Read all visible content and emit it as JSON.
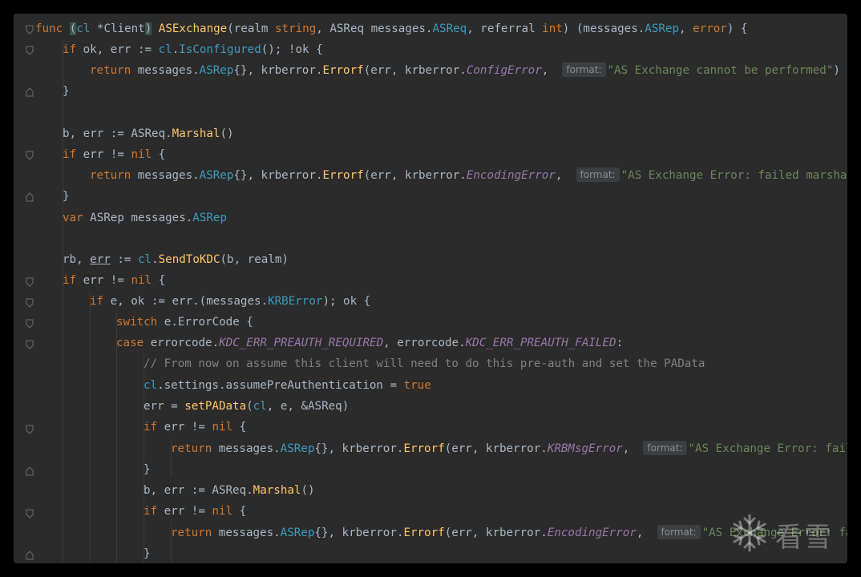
{
  "code": {
    "l1": {
      "func": "func",
      "recv_open": "(",
      "recv_name": "cl",
      "recv_type": " *Client",
      "recv_close": ")",
      "name": "ASExchange",
      "p1": "(realm ",
      "t1": "string",
      "p2": ", ASReq messages.",
      "t2": "ASReq",
      "p3": ", referral ",
      "t3": "int",
      "p4": ") (messages.",
      "t4": "ASRep",
      "p5": ", ",
      "t5": "error",
      "p6": ") {"
    },
    "l2": {
      "if": "if",
      "a": " ok, err := ",
      "cl": "cl",
      "b": ".",
      "m": "IsConfigured",
      "c": "(); !ok {"
    },
    "l3": {
      "ret": "return",
      "a": " messages.",
      "t": "ASRep",
      "b": "{}, krberror.",
      "m": "Errorf",
      "c": "(err, krberror.",
      "e": "ConfigError",
      "d": ", ",
      "hint": "format:",
      "s": "\"AS Exchange cannot be performed\"",
      "end": ")"
    },
    "l4": {
      "a": "}"
    },
    "l6": {
      "a": "b, err := ASReq.",
      "m": "Marshal",
      "b": "()"
    },
    "l7": {
      "if": "if",
      "a": " err != ",
      "nil": "nil",
      "b": " {"
    },
    "l8": {
      "ret": "return",
      "a": " messages.",
      "t": "ASRep",
      "b": "{}, krberror.",
      "m": "Errorf",
      "c": "(err, krberror.",
      "e": "EncodingError",
      "d": ", ",
      "hint": "format:",
      "s": "\"AS Exchange Error: failed marshalin"
    },
    "l9": {
      "a": "}"
    },
    "l10": {
      "var": "var",
      "a": " ASRep messages.",
      "t": "ASRep"
    },
    "l12": {
      "a": "rb, ",
      "err": "err",
      "b": " := ",
      "cl": "cl",
      "c": ".",
      "m": "SendToKDC",
      "d": "(b, realm)"
    },
    "l13": {
      "if": "if",
      "a": " err != ",
      "nil": "nil",
      "b": " {"
    },
    "l14": {
      "if": "if",
      "a": " e, ok := err.(messages.",
      "t": "KRBError",
      "b": "); ok {"
    },
    "l15": {
      "sw": "switch",
      "a": " e.ErrorCode {"
    },
    "l16": {
      "case": "case",
      "a": " errorcode.",
      "c1": "KDC_ERR_PREAUTH_REQUIRED",
      "b": ", errorcode.",
      "c2": "KDC_ERR_PREAUTH_FAILED",
      "c": ":"
    },
    "l17": {
      "cmt": "// From now on assume this client will need to do this pre-auth and set the PAData"
    },
    "l18": {
      "cl": "cl",
      "a": ".settings.assumePreAuthentication = ",
      "v": "true"
    },
    "l19": {
      "a": "err = ",
      "m": "setPAData",
      "b": "(",
      "cl": "cl",
      "c": ", e, &ASReq)"
    },
    "l20": {
      "if": "if",
      "a": " err != ",
      "nil": "nil",
      "b": " {"
    },
    "l21": {
      "ret": "return",
      "a": " messages.",
      "t": "ASRep",
      "b": "{}, krberror.",
      "m": "Errorf",
      "c": "(err, krberror.",
      "e": "KRBMsgError",
      "d": ", ",
      "hint": "format:",
      "s": "\"AS Exchange Error: failed"
    },
    "l22": {
      "a": "}"
    },
    "l23": {
      "a": "b, err := ASReq.",
      "m": "Marshal",
      "b": "()"
    },
    "l24": {
      "if": "if",
      "a": " err != ",
      "nil": "nil",
      "b": " {"
    },
    "l25": {
      "ret": "return",
      "a": " messages.",
      "t": "ASRep",
      "b": "{}, krberror.",
      "m": "Errorf",
      "c": "(err, krberror.",
      "e": "EncodingError",
      "d": ", ",
      "hint": "format:",
      "s": "\"AS Exchange Error: fai"
    },
    "l26": {
      "a": "}"
    }
  },
  "watermark": {
    "text": "看雪",
    "icon": "snowflake-icon"
  },
  "colors": {
    "background": "#2b2b2b",
    "keyword": "#cc7832",
    "function": "#ffc66d",
    "string": "#6a8759",
    "constant": "#9876aa",
    "type": "#3f9bbf",
    "comment": "#808080"
  }
}
